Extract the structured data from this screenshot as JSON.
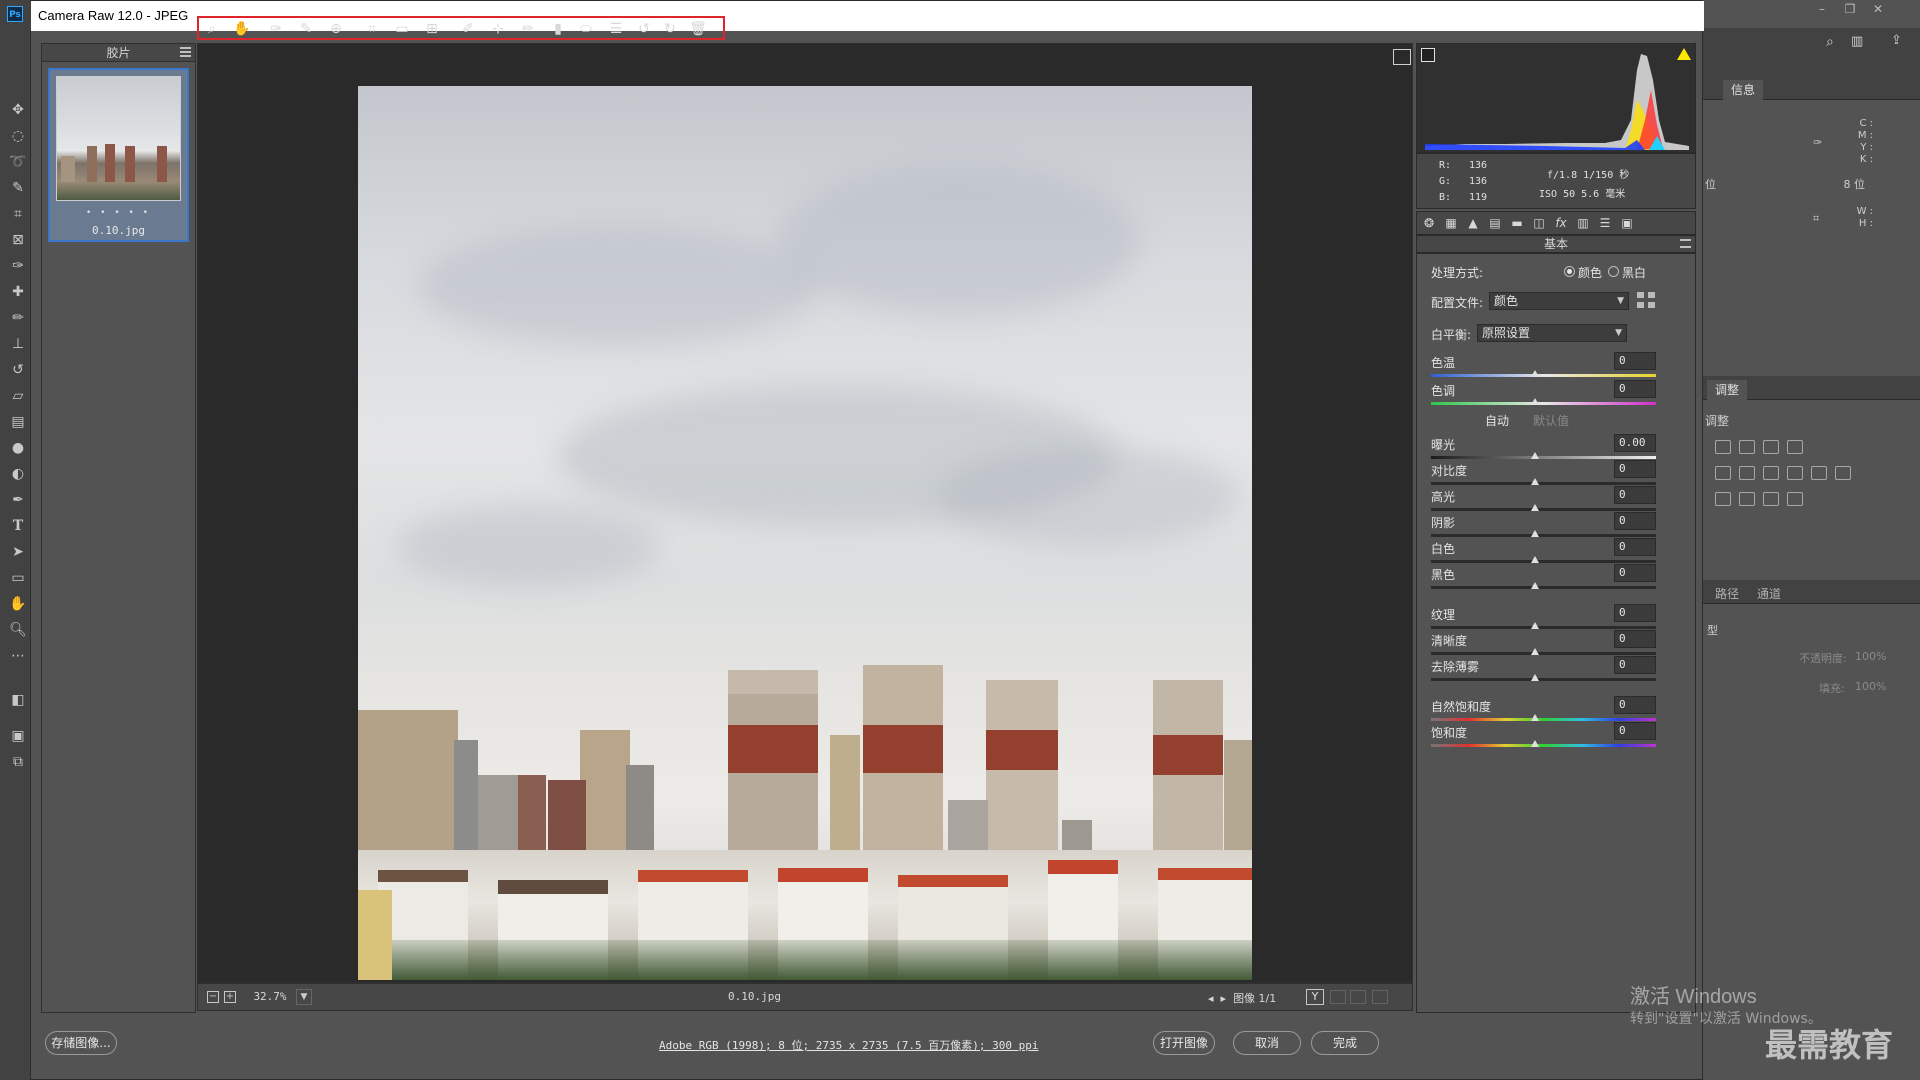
{
  "window": {
    "title": "Camera Raw 12.0 -  JPEG",
    "app_icon": "Ps"
  },
  "filmstrip": {
    "header": "胶片",
    "file_name": "0.10.jpg",
    "stars": "• • • • •"
  },
  "toolbar": {
    "tools": [
      "zoom-icon",
      "hand-icon",
      "white-balance-icon",
      "color-sampler-icon",
      "target-adjust-icon",
      "crop-icon",
      "straighten-icon",
      "transform-icon",
      "spot-removal-icon",
      "red-eye-icon",
      "adjustment-brush-icon",
      "graduated-filter-icon",
      "radial-filter-icon",
      "presets-icon",
      "rotate-left-icon",
      "rotate-right-icon",
      "trash-icon"
    ]
  },
  "preview": {
    "zoom": "32.7%",
    "file_name": "0.10.jpg",
    "image_counter": "图像 1/1",
    "before_after": "Y"
  },
  "readout": {
    "r_label": "R:",
    "r": "136",
    "g_label": "G:",
    "g": "136",
    "b_label": "B:",
    "b": "119",
    "camera_line1": "f/1.8  1/150 秒",
    "camera_line2": "ISO 50  5.6 毫米"
  },
  "basic": {
    "header": "基本",
    "treatment_label": "处理方式:",
    "treatment_color": "颜色",
    "treatment_bw": "黑白",
    "profile_label": "配置文件:",
    "profile_value": "颜色",
    "wb_label": "白平衡:",
    "wb_value": "原照设置",
    "auto": "自动",
    "default": "默认值",
    "sliders": {
      "temp": {
        "label": "色温",
        "value": "0"
      },
      "tint": {
        "label": "色调",
        "value": "0"
      },
      "exposure": {
        "label": "曝光",
        "value": "0.00"
      },
      "contrast": {
        "label": "对比度",
        "value": "0"
      },
      "highlights": {
        "label": "高光",
        "value": "0"
      },
      "shadows": {
        "label": "阴影",
        "value": "0"
      },
      "whites": {
        "label": "白色",
        "value": "0"
      },
      "blacks": {
        "label": "黑色",
        "value": "0"
      },
      "texture": {
        "label": "纹理",
        "value": "0"
      },
      "clarity": {
        "label": "清晰度",
        "value": "0"
      },
      "dehaze": {
        "label": "去除薄雾",
        "value": "0"
      },
      "vibrance": {
        "label": "自然饱和度",
        "value": "0"
      },
      "saturation": {
        "label": "饱和度",
        "value": "0"
      }
    }
  },
  "footer": {
    "save_image": "存储图像...",
    "workflow": "Adobe RGB (1998); 8 位; 2735 x 2735 (7.5 百万像素); 300 ppi",
    "open_image": "打开图像",
    "cancel": "取消",
    "done": "完成"
  },
  "ps_panels": {
    "info_tab": "信息",
    "info_c": "C :",
    "info_m": "M :",
    "info_y": "Y :",
    "info_k": "K :",
    "info_bits": "8 位",
    "info_bits_left": "位",
    "info_w": "W :",
    "info_h": "H :",
    "adjust_tab": "调整",
    "adjust_sub": "调整",
    "paths_tab": "路径",
    "channels_tab": "通道",
    "opacity_label": "不透明度:",
    "opacity_value": "100%",
    "fill_label": "填充:",
    "fill_value": "100%",
    "kind": "型"
  },
  "watermark": {
    "line1": "激活 Windows",
    "line2": "转到\"设置\"以激活 Windows。",
    "brand": "最需教育"
  },
  "colors": {
    "accent_red": "#e0242c",
    "selection_blue": "#3b77c8"
  }
}
